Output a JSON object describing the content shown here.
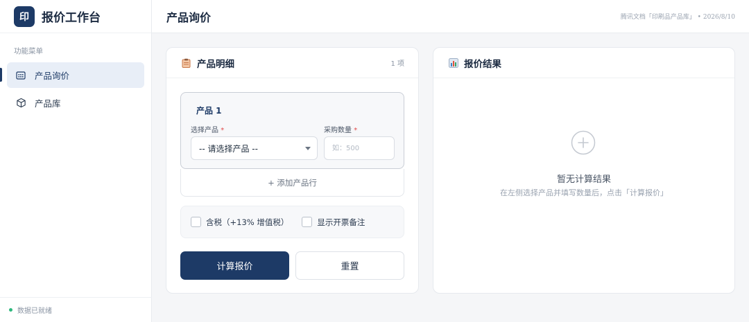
{
  "app": {
    "logo_char": "印",
    "title": "报价工作台"
  },
  "sidebar": {
    "heading": "功能菜单",
    "items": [
      {
        "label": "产品询价",
        "icon": "grid-icon",
        "active": true
      },
      {
        "label": "产品库",
        "icon": "cube-icon",
        "active": false
      }
    ],
    "status": "数据已就绪",
    "status_color": "#2db87d"
  },
  "header": {
    "page_title": "产品询价",
    "doc_ref": "腾讯文档「印刷品产品库」 • 2026/8/10"
  },
  "details": {
    "title": "产品明细",
    "icon": "clipboard-icon",
    "count": "1 项",
    "products": [
      {
        "name": "产品 1",
        "select_label": "选择产品",
        "select_value": "-- 请选择产品 --",
        "qty_label": "采购数量",
        "required_mark": "*",
        "qty_placeholder": "如：500"
      }
    ],
    "add_row": "+ 添加产品行",
    "options": {
      "tax": "含税（+13% 增值税）",
      "invoice_note": "显示开票备注"
    },
    "calc_button": "计算报价",
    "reset_button": "重置"
  },
  "result": {
    "title": "报价结果",
    "icon": "bar-chart-icon",
    "empty_title": "暂无计算结果",
    "empty_hint": "在左侧选择产品并填写数量后，点击「计算报价」"
  },
  "colors": {
    "primary": "#1d3a66",
    "required": "#e04848"
  }
}
